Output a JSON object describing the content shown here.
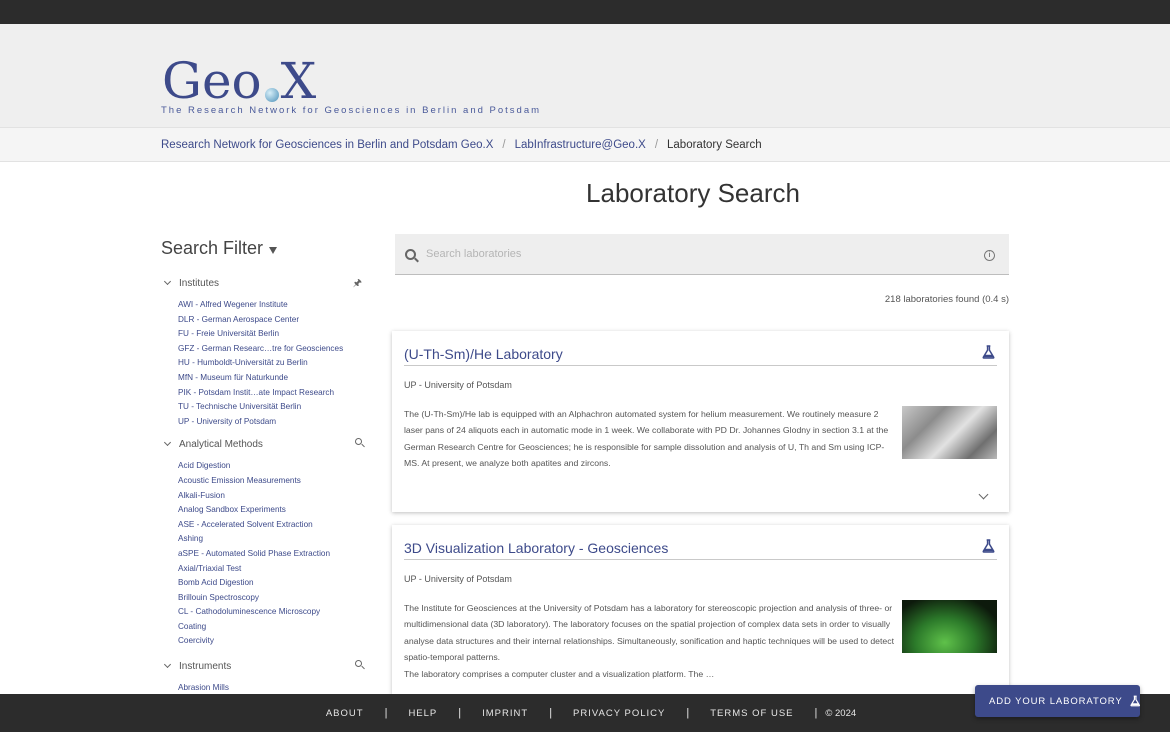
{
  "header": {
    "logo_text_left": "Geo",
    "logo_text_right": "X",
    "tagline": "The Research Network for Geosciences in Berlin and Potsdam"
  },
  "breadcrumb": {
    "items": [
      "Research Network for Geosciences in Berlin and Potsdam Geo.X",
      "LabInfrastructure@Geo.X",
      "Laboratory Search"
    ],
    "separator": "/"
  },
  "page_title": "Laboratory Search",
  "filter": {
    "title": "Search Filter",
    "groups": [
      {
        "label": "Institutes",
        "items": [
          "AWI - Alfred Wegener Institute",
          "DLR - German Aerospace Center",
          "FU - Freie Universität Berlin",
          "GFZ - German Researc…tre for Geosciences",
          "HU - Humboldt-Universität zu Berlin",
          "MfN - Museum für Naturkunde",
          "PIK - Potsdam Instit…ate Impact Research",
          "TU - Technische Universität Berlin",
          "UP - University of Potsdam"
        ]
      },
      {
        "label": "Analytical Methods",
        "items": [
          "Acid Digestion",
          "Acoustic Emission Measurements",
          "Alkali-Fusion",
          "Analog Sandbox Experiments",
          "ASE - Accelerated Solvent Extraction",
          "Ashing",
          "aSPE - Automated Solid Phase Extraction",
          "Axial/Triaxial Test",
          "Bomb Acid Digestion",
          "Brillouin Spectroscopy",
          "CL - Cathodoluminescence Microscopy",
          "Coating",
          "Coercivity"
        ]
      },
      {
        "label": "Instruments",
        "items": [
          "Abrasion Mills"
        ]
      }
    ]
  },
  "search": {
    "placeholder": "Search laboratories"
  },
  "results_count": "218 laboratories found (0.4 s)",
  "results": [
    {
      "title": "(U-Th-Sm)/He Laboratory",
      "institute": "UP - University of Potsdam",
      "description": "The (U-Th-Sm)/He lab is equipped with an Alphachron automated system for helium measurement. We routinely measure 2 laser pans of 24 aliquots each in automatic mode in 1 week. We collaborate with PD Dr. Johannes Glodny in section 3.1 at the German Research Centre for Geosciences; he is responsible for sample dissolution and analysis of U, Th and Sm using ICP-MS. At present, we analyze both apatites and zircons."
    },
    {
      "title": "3D Visualization Laboratory - Geosciences",
      "institute": "UP - University of Potsdam",
      "description": "The Institute for Geosciences at the University of Potsdam has a laboratory for stereoscopic projection and analysis of three- or multidimensional data (3D laboratory). The laboratory focuses on the spatial projection of complex data sets in order to visually analyse data structures and their internal relationships. Simultaneously, sonification and haptic techniques will be used to detect spatio-temporal patterns.",
      "description_2": "The laboratory comprises a computer cluster and a visualization platform. The …"
    }
  ],
  "footer": {
    "links": [
      "ABOUT",
      "HELP",
      "IMPRINT",
      "PRIVACY POLICY",
      "TERMS OF USE"
    ],
    "separator": "|",
    "copyright": "© 2024"
  },
  "add_lab_button": "ADD YOUR LABORATORY",
  "colors": {
    "brand": "#3d4a8a",
    "dark_bar": "#2c2c2c",
    "header_bg": "#efefef"
  }
}
